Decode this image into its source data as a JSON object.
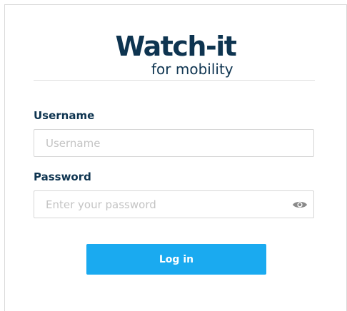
{
  "logo": {
    "title": "Watch-it",
    "subtitle": "for mobility"
  },
  "form": {
    "username_label": "Username",
    "username_placeholder": "Username",
    "username_value": "",
    "password_label": "Password",
    "password_placeholder": "Enter your password",
    "password_value": "",
    "login_label": "Log in"
  },
  "icons": {
    "password_toggle": "eye-icon"
  },
  "colors": {
    "brand": "#0e3450",
    "accent": "#1aaaf0"
  }
}
